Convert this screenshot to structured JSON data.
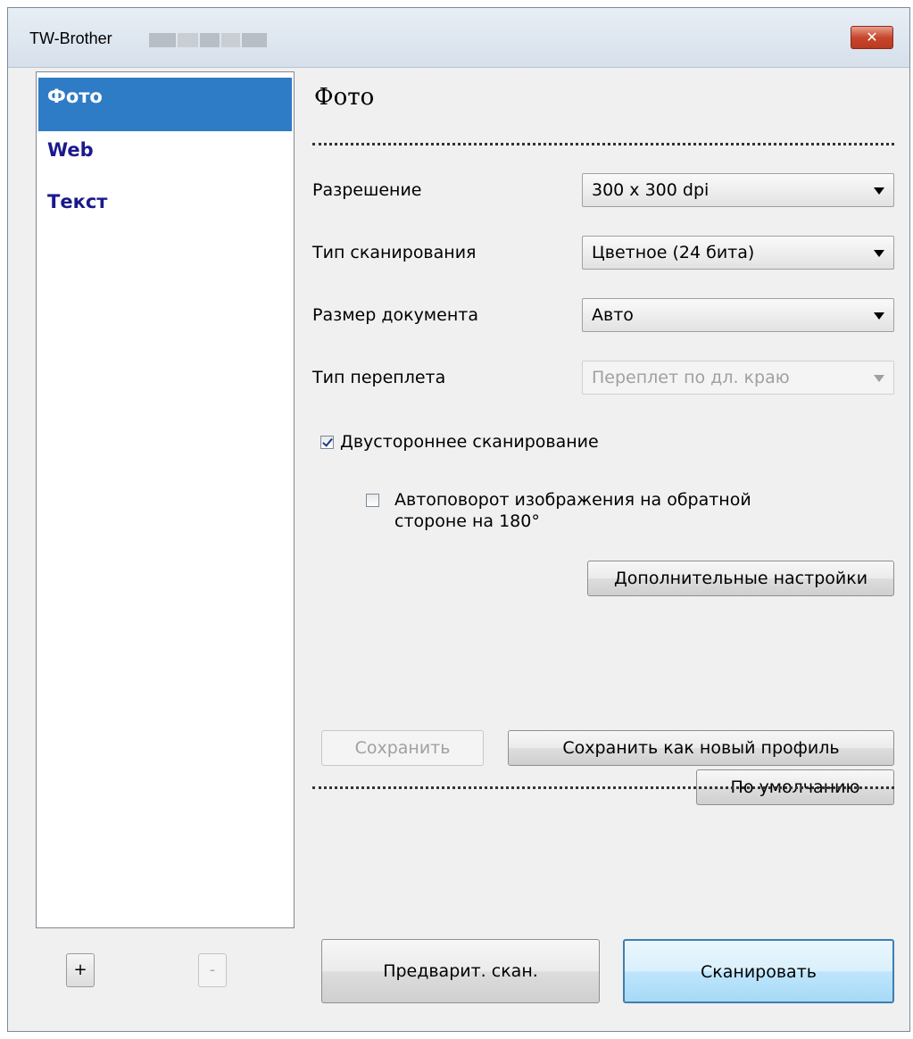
{
  "window": {
    "title": "TW-Brother",
    "close_label": "✕"
  },
  "sidebar": {
    "items": [
      {
        "label": "Фото",
        "selected": true
      },
      {
        "label": "Web",
        "selected": false
      },
      {
        "label": "Текст",
        "selected": false
      }
    ],
    "add_label": "+",
    "remove_label": "-"
  },
  "panel": {
    "title": "Фото",
    "fields": [
      {
        "label": "Разрешение",
        "value": "300 x 300 dpi",
        "enabled": true
      },
      {
        "label": "Тип сканирования",
        "value": "Цветное (24 бита)",
        "enabled": true
      },
      {
        "label": "Размер документа",
        "value": "Авто",
        "enabled": true
      },
      {
        "label": "Тип переплета",
        "value": "Переплет по дл. краю",
        "enabled": false
      }
    ],
    "duplex": {
      "label": "Двустороннее сканирование",
      "checked": true
    },
    "autorotate": {
      "label_line1": "Автоповорот изображения на обратной",
      "label_line2": "стороне на 180°",
      "checked": false
    },
    "advanced_button": "Дополнительные настройки",
    "default_button": "По умолчанию",
    "save_button": "Сохранить",
    "save_new_button": "Сохранить как новый профиль",
    "prescan_button": "Предварит. скан.",
    "scan_button": "Сканировать"
  },
  "colors": {
    "selection": "#2e7bc6",
    "list_text": "#1a1a8c",
    "close_button": "#c8472d"
  }
}
